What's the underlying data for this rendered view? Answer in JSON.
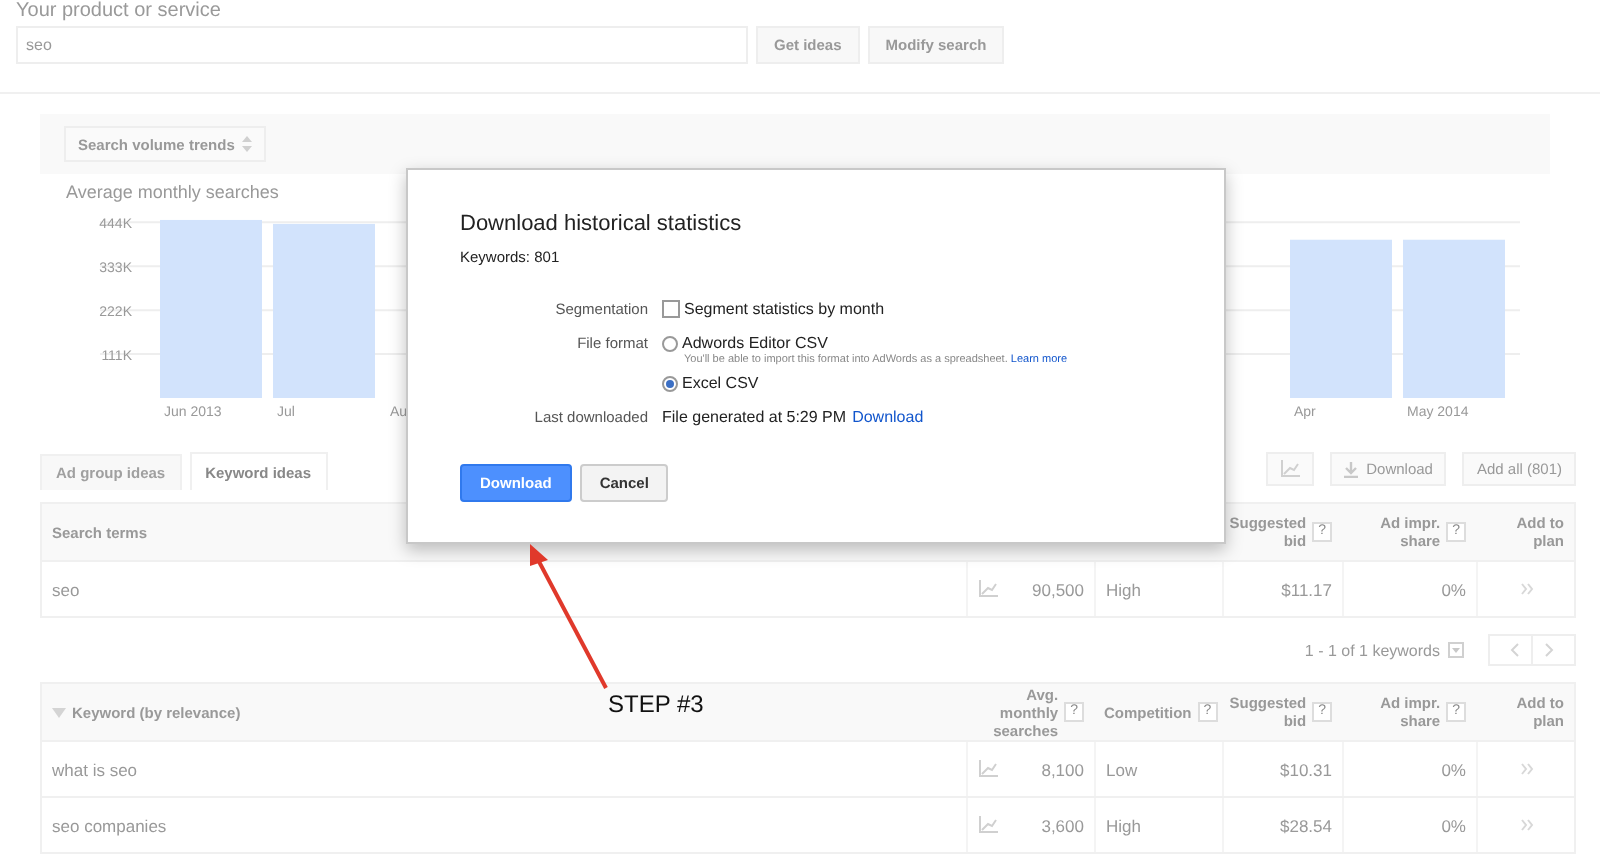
{
  "search": {
    "label": "Your product or service",
    "value": "seo",
    "buttons": [
      "Get ideas",
      "Modify search"
    ]
  },
  "trends": {
    "select": "Search volume trends",
    "chart_data": {
      "type": "bar",
      "title": "Average monthly searches",
      "categories": [
        "Jun 2013",
        "Jul",
        "Au",
        null,
        null,
        null,
        null,
        null,
        null,
        null,
        "Apr",
        "May 2014"
      ],
      "values": [
        450000,
        440000,
        null,
        null,
        null,
        null,
        null,
        null,
        null,
        null,
        400000,
        400000
      ],
      "ylim": [
        0,
        460000
      ],
      "grid": true,
      "yticks": [
        {
          "value": 111000,
          "label": "111K"
        },
        {
          "value": 222000,
          "label": "222K"
        },
        {
          "value": 333000,
          "label": "333K"
        },
        {
          "value": 444000,
          "label": "444K"
        }
      ]
    }
  },
  "tabs": [
    {
      "label": "Ad group ideas",
      "selected": false
    },
    {
      "label": "Keyword ideas",
      "selected": true
    }
  ],
  "toolbar": {
    "download": "Download",
    "add_all": "Add all (801)"
  },
  "search_terms": {
    "columns": [
      {
        "kind": "term",
        "label": "Search terms"
      },
      {
        "kind": "bid",
        "label": "Suggested bid",
        "hint": "?"
      },
      {
        "kind": "share",
        "label": "Ad impr. share",
        "hint": "?"
      },
      {
        "kind": "plan",
        "label": "Add to plan"
      }
    ],
    "rows": [
      {
        "keyword": "seo",
        "searches": "90,500",
        "competition": "High",
        "bid": "$11.17",
        "share": "0%"
      }
    ]
  },
  "pagination": {
    "text": "1 - 1 of 1 keywords"
  },
  "keyword_ideas": {
    "columns": [
      {
        "kind": "term",
        "label": "Keyword (by relevance)"
      },
      {
        "kind": "searches",
        "label": "Avg. monthly searches",
        "hint": "?"
      },
      {
        "kind": "competition",
        "label": "Competition",
        "hint": "?"
      },
      {
        "kind": "bid",
        "label": "Suggested bid",
        "hint": "?"
      },
      {
        "kind": "share",
        "label": "Ad impr. share",
        "hint": "?"
      },
      {
        "kind": "plan",
        "label": "Add to plan"
      }
    ],
    "rows": [
      {
        "keyword": "what is seo",
        "searches": "8,100",
        "competition": "Low",
        "bid": "$10.31",
        "share": "0%"
      },
      {
        "keyword": "seo companies",
        "searches": "3,600",
        "competition": "High",
        "bid": "$28.54",
        "share": "0%"
      }
    ]
  },
  "dialog": {
    "title": "Download historical statistics",
    "subtitle": "Keywords: 801",
    "segmentation": {
      "label": "Segmentation",
      "option": "Segment statistics by month",
      "checked": false
    },
    "file_format": {
      "label": "File format",
      "options": [
        {
          "label": "Adwords Editor CSV",
          "selected": false,
          "hint": "You'll be able to import this format into AdWords as a spreadsheet.",
          "link": "Learn more"
        },
        {
          "label": "Excel CSV",
          "selected": true
        }
      ]
    },
    "last_downloaded": {
      "label": "Last downloaded",
      "text": "File generated at 5:29 PM",
      "link": "Download"
    },
    "buttons": [
      {
        "label": "Download",
        "kind": "primary"
      },
      {
        "label": "Cancel",
        "kind": "secondary"
      }
    ]
  },
  "annotation": {
    "text": "STEP #3"
  }
}
